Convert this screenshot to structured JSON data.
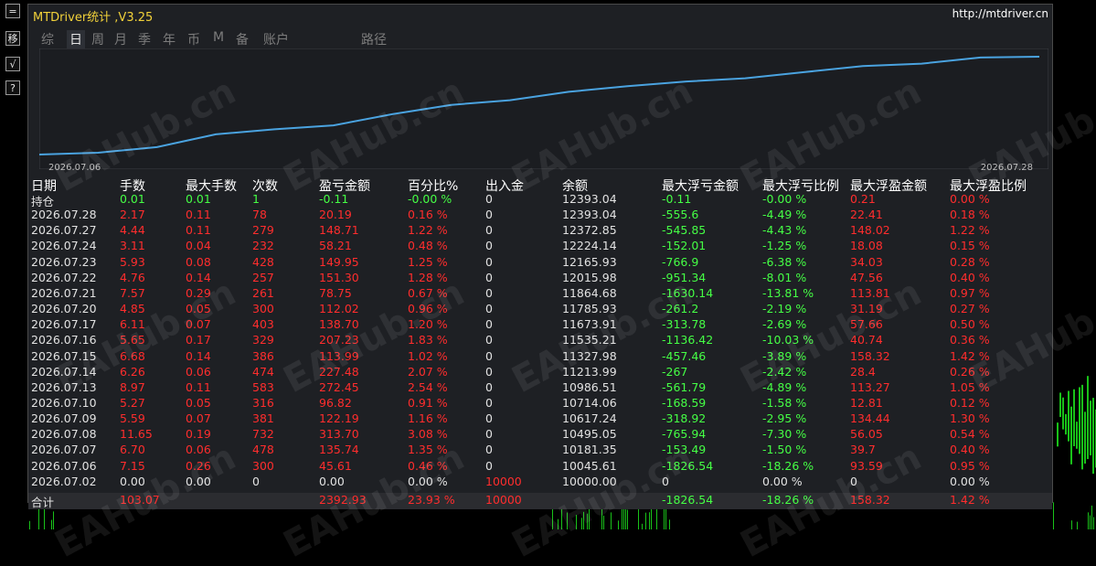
{
  "title": "MTDriver统计 ,V3.25",
  "site": "http://mtdriver.cn",
  "toolbar": {
    "b1": "=",
    "b2": "移",
    "b3": "√",
    "b4": "?"
  },
  "tabs": [
    "综",
    "日",
    "周",
    "月",
    "季",
    "年",
    "币",
    "M",
    "备",
    "账户",
    "路径"
  ],
  "active_tab": "日",
  "equity": {
    "start_date": "2026.07.06",
    "end_date": "2026.07.28",
    "values": [
      10000,
      10045.61,
      10181.35,
      10495.05,
      10617.24,
      10714.06,
      10986.51,
      11213.99,
      11327.98,
      11535.21,
      11673.91,
      11785.93,
      11864.68,
      12015.98,
      12165.93,
      12224.14,
      12372.85,
      12393.04
    ],
    "line_color": "#4aa3e0"
  },
  "headers": [
    "日期",
    "手数",
    "最大手数",
    "次数",
    "盈亏金额",
    "百分比%",
    "出入金",
    "余额",
    "最大浮亏金额",
    "最大浮亏比例",
    "最大浮盈金额",
    "最大浮盈比例"
  ],
  "rows": [
    [
      "持仓",
      "0.01",
      "0.01",
      "1",
      "-0.11",
      "-0.00 %",
      "0",
      "12393.04",
      "-0.11",
      "-0.00 %",
      "0.21",
      "0.00 %"
    ],
    [
      "2026.07.28",
      "2.17",
      "0.11",
      "78",
      "20.19",
      "0.16 %",
      "0",
      "12393.04",
      "-555.6",
      "-4.49 %",
      "22.41",
      "0.18 %"
    ],
    [
      "2026.07.27",
      "4.44",
      "0.11",
      "279",
      "148.71",
      "1.22 %",
      "0",
      "12372.85",
      "-545.85",
      "-4.43 %",
      "148.02",
      "1.22 %"
    ],
    [
      "2026.07.24",
      "3.11",
      "0.04",
      "232",
      "58.21",
      "0.48 %",
      "0",
      "12224.14",
      "-152.01",
      "-1.25 %",
      "18.08",
      "0.15 %"
    ],
    [
      "2026.07.23",
      "5.93",
      "0.08",
      "428",
      "149.95",
      "1.25 %",
      "0",
      "12165.93",
      "-766.9",
      "-6.38 %",
      "34.03",
      "0.28 %"
    ],
    [
      "2026.07.22",
      "4.76",
      "0.14",
      "257",
      "151.30",
      "1.28 %",
      "0",
      "12015.98",
      "-951.34",
      "-8.01 %",
      "47.56",
      "0.40 %"
    ],
    [
      "2026.07.21",
      "7.57",
      "0.29",
      "261",
      "78.75",
      "0.67 %",
      "0",
      "11864.68",
      "-1630.14",
      "-13.81 %",
      "113.81",
      "0.97 %"
    ],
    [
      "2026.07.20",
      "4.85",
      "0.05",
      "300",
      "112.02",
      "0.96 %",
      "0",
      "11785.93",
      "-261.2",
      "-2.19 %",
      "31.19",
      "0.27 %"
    ],
    [
      "2026.07.17",
      "6.11",
      "0.07",
      "403",
      "138.70",
      "1.20 %",
      "0",
      "11673.91",
      "-313.78",
      "-2.69 %",
      "57.66",
      "0.50 %"
    ],
    [
      "2026.07.16",
      "5.65",
      "0.17",
      "329",
      "207.23",
      "1.83 %",
      "0",
      "11535.21",
      "-1136.42",
      "-10.03 %",
      "40.74",
      "0.36 %"
    ],
    [
      "2026.07.15",
      "6.68",
      "0.14",
      "386",
      "113.99",
      "1.02 %",
      "0",
      "11327.98",
      "-457.46",
      "-3.89 %",
      "158.32",
      "1.42 %"
    ],
    [
      "2026.07.14",
      "6.26",
      "0.06",
      "474",
      "227.48",
      "2.07 %",
      "0",
      "11213.99",
      "-267",
      "-2.42 %",
      "28.4",
      "0.26 %"
    ],
    [
      "2026.07.13",
      "8.97",
      "0.11",
      "583",
      "272.45",
      "2.54 %",
      "0",
      "10986.51",
      "-561.79",
      "-4.89 %",
      "113.27",
      "1.05 %"
    ],
    [
      "2026.07.10",
      "5.27",
      "0.05",
      "316",
      "96.82",
      "0.91 %",
      "0",
      "10714.06",
      "-168.59",
      "-1.58 %",
      "12.81",
      "0.12 %"
    ],
    [
      "2026.07.09",
      "5.59",
      "0.07",
      "381",
      "122.19",
      "1.16 %",
      "0",
      "10617.24",
      "-318.92",
      "-2.95 %",
      "134.44",
      "1.30 %"
    ],
    [
      "2026.07.08",
      "11.65",
      "0.19",
      "732",
      "313.70",
      "3.08 %",
      "0",
      "10495.05",
      "-765.94",
      "-7.30 %",
      "56.05",
      "0.54 %"
    ],
    [
      "2026.07.07",
      "6.70",
      "0.06",
      "478",
      "135.74",
      "1.35 %",
      "0",
      "10181.35",
      "-153.49",
      "-1.50 %",
      "39.7",
      "0.40 %"
    ],
    [
      "2026.07.06",
      "7.15",
      "0.26",
      "300",
      "45.61",
      "0.46 %",
      "0",
      "10045.61",
      "-1826.54",
      "-18.26 %",
      "93.59",
      "0.95 %"
    ],
    [
      "2026.07.02",
      "0.00",
      "0.00",
      "0",
      "0.00",
      "0.00 %",
      "10000",
      "10000.00",
      "0",
      "0.00 %",
      "0",
      "0.00 %"
    ]
  ],
  "total": [
    "合计",
    "103.07",
    "",
    "",
    "2392.93",
    "23.93 %",
    "10000",
    "",
    "-1826.54",
    "-18.26 %",
    "158.32",
    "1.42 %"
  ],
  "watermark": "EAHub.cn",
  "colors": {
    "profit": "#ff2d2d",
    "loss": "#45ff45",
    "neutral": "#e2e2e2",
    "title": "#f2d23a"
  }
}
